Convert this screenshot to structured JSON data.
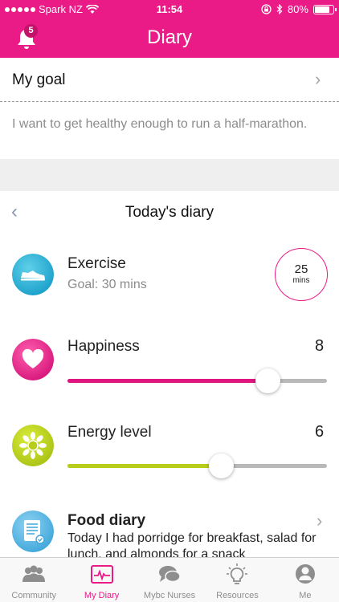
{
  "status_bar": {
    "carrier": "Spark NZ",
    "time": "11:54",
    "battery_text": "80%",
    "battery_level": 0.8
  },
  "nav": {
    "title": "Diary",
    "notification_count": "5"
  },
  "goal": {
    "label": "My goal",
    "text": "I want to get healthy enough to run a half-marathon."
  },
  "diary": {
    "title": "Today's diary",
    "exercise": {
      "title": "Exercise",
      "goal": "Goal: 30 mins",
      "value": "25",
      "unit": "mins"
    },
    "happiness": {
      "title": "Happiness",
      "value": "8",
      "level": 0.77,
      "color": "#e0157f"
    },
    "energy": {
      "title": "Energy level",
      "value": "6",
      "level": 0.59,
      "color": "#b8cc1a"
    },
    "food": {
      "title": "Food diary",
      "text": "Today I had porridge for breakfast, salad for lunch, and almonds for a snack"
    }
  },
  "tabs": [
    {
      "label": "Community",
      "icon": "community-icon",
      "active": false
    },
    {
      "label": "My Diary",
      "icon": "diary-icon",
      "active": true
    },
    {
      "label": "Mybc Nurses",
      "icon": "chat-icon",
      "active": false
    },
    {
      "label": "Resources",
      "icon": "lightbulb-icon",
      "active": false
    },
    {
      "label": "Me",
      "icon": "person-icon",
      "active": false
    }
  ],
  "colors": {
    "brand": "#ea1a86",
    "inactive_tab": "#8e8e8e"
  }
}
